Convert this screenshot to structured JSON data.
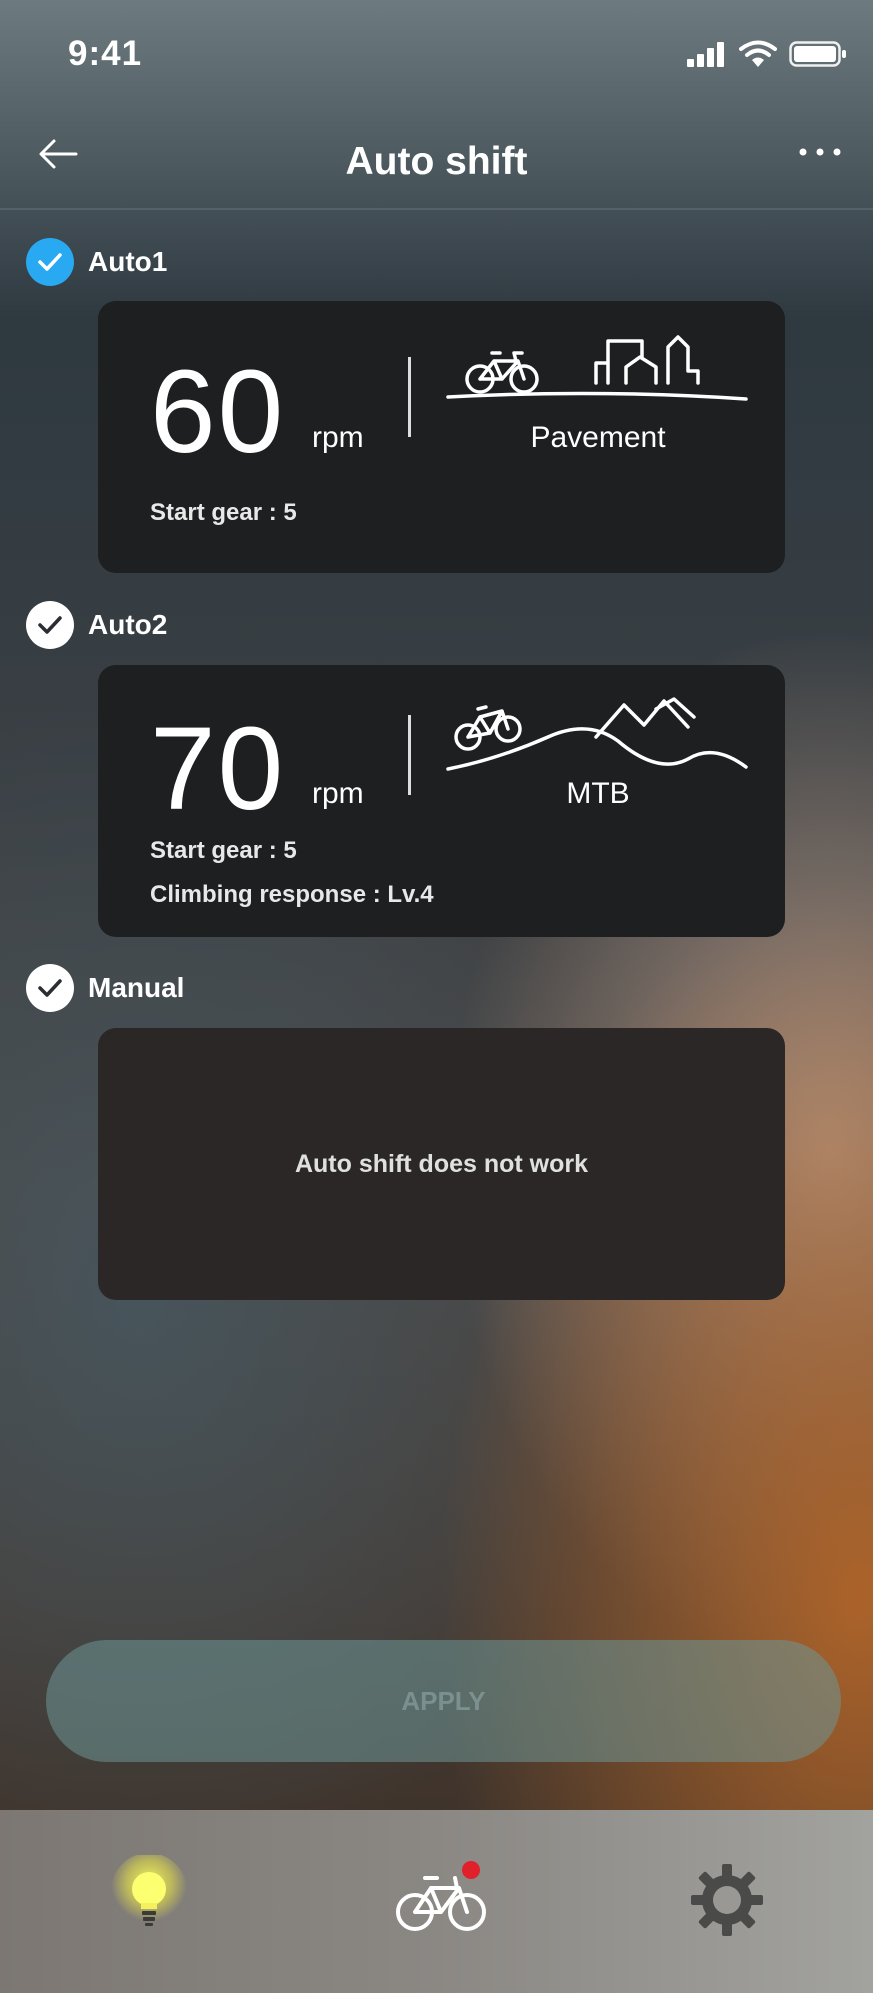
{
  "status_bar": {
    "time": "9:41"
  },
  "header": {
    "title": "Auto shift"
  },
  "options": [
    {
      "label": "Auto1",
      "checked": true,
      "value": "60",
      "unit": "rpm",
      "terrain": "Pavement",
      "start_gear": "Start gear : 5"
    },
    {
      "label": "Auto2",
      "checked": false,
      "value": "70",
      "unit": "rpm",
      "terrain": "MTB",
      "start_gear": "Start gear : 5",
      "climbing": "Climbing response : Lv.4"
    },
    {
      "label": "Manual",
      "checked": false,
      "message": "Auto shift does not work"
    }
  ],
  "apply_button": {
    "label": "APPLY"
  },
  "tabs": [
    {
      "icon": "lightbulb-icon",
      "active": true
    },
    {
      "icon": "bicycle-icon",
      "has_notification": true
    },
    {
      "icon": "gear-icon"
    }
  ],
  "colors": {
    "check_active": "#29a9f2",
    "notification_dot": "#e0202a",
    "bulb_glow": "#f4f040"
  }
}
